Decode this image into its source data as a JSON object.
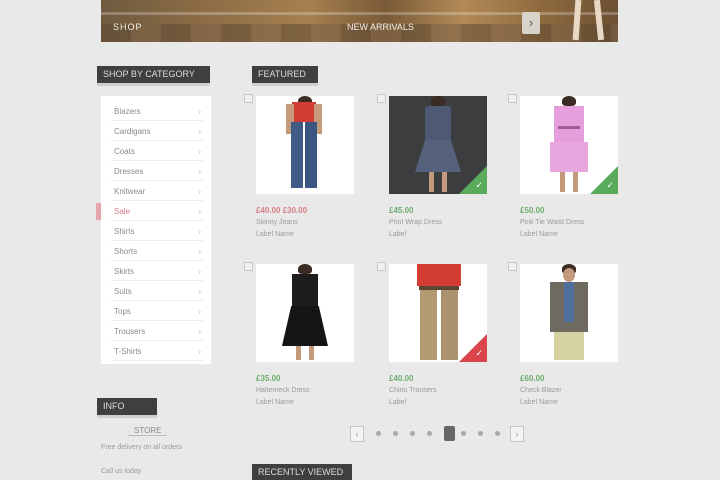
{
  "banner": {
    "label": "SHOP",
    "caption": "NEW ARRIVALS",
    "arrow_icon": "›"
  },
  "sidebar": {
    "categories_title": "SHOP BY CATEGORY",
    "categories": [
      {
        "label": "Blazers",
        "count": "›"
      },
      {
        "label": "Cardigans",
        "count": "›"
      },
      {
        "label": "Coats",
        "count": "›"
      },
      {
        "label": "Dresses",
        "count": "›"
      },
      {
        "label": "Knitwear",
        "count": "›"
      },
      {
        "label": "Sale",
        "count": "›",
        "active": true
      },
      {
        "label": "Shirts",
        "count": "›"
      },
      {
        "label": "Shorts",
        "count": "›"
      },
      {
        "label": "Skirts",
        "count": "›"
      },
      {
        "label": "Suits",
        "count": "›"
      },
      {
        "label": "Tops",
        "count": "›"
      },
      {
        "label": "Trousers",
        "count": "›"
      },
      {
        "label": "T-Shirts",
        "count": "›"
      }
    ],
    "info_title": "INFO",
    "info_logo": "STORE",
    "info_lines": [
      "Free delivery on all orders",
      "Call us today"
    ]
  },
  "main": {
    "title": "FEATURED",
    "second_title": "RECENTLY VIEWED",
    "products": [
      {
        "price": "£40.00 £30.00",
        "name": "Skinny Jeans",
        "brand": "Label Name",
        "sale": true,
        "ribbon": "none"
      },
      {
        "price": "£45.00",
        "name": "Print Wrap Dress",
        "brand": "Label",
        "sale": false,
        "ribbon": "green"
      },
      {
        "price": "£50.00",
        "name": "Pink Tie Waist Dress",
        "brand": "Label Name",
        "sale": false,
        "ribbon": "green"
      },
      {
        "price": "£35.00",
        "name": "Halterneck Dress",
        "brand": "Label Name",
        "sale": false,
        "ribbon": "none"
      },
      {
        "price": "£40.00",
        "name": "Chino Trousers",
        "brand": "Label",
        "sale": false,
        "ribbon": "red"
      },
      {
        "price": "£60.00",
        "name": "Check Blazer",
        "brand": "Label Name",
        "sale": false,
        "ribbon": "none"
      }
    ],
    "ribbon_mark": "✓"
  },
  "pager": {
    "prev": "‹",
    "next": "›",
    "pages": [
      "1",
      "2",
      "3",
      "4",
      "5",
      "6",
      "7",
      "8"
    ],
    "current": 5
  },
  "colors": {
    "accent_sale": "#d87f86",
    "accent_price": "#6fae72",
    "ribbon_green": "#5aaa5c",
    "ribbon_red": "#d9454a",
    "header_bg": "#3f3f3f"
  }
}
